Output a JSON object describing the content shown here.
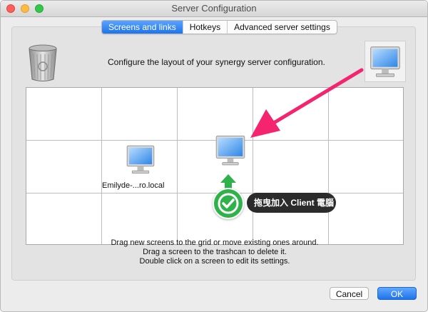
{
  "window": {
    "title": "Server Configuration"
  },
  "tabs": [
    {
      "label": "Screens and links",
      "active": true
    },
    {
      "label": "Hotkeys",
      "active": false
    },
    {
      "label": "Advanced server settings",
      "active": false
    }
  ],
  "instruction": "Configure the layout of your synergy server configuration.",
  "screens": [
    {
      "label": "Emilyde-...ro.local"
    },
    {
      "label": ""
    }
  ],
  "callout": {
    "text": "拖曳加入 Client 電腦"
  },
  "help_lines": [
    "Drag new screens to the grid or move existing ones around.",
    "Drag a screen to the trashcan to delete it.",
    "Double click on a screen to edit its settings."
  ],
  "buttons": {
    "cancel": "Cancel",
    "ok": "OK"
  },
  "colors": {
    "accent": "#1e73e8",
    "annotation_arrow": "#f4256e",
    "callout_check": "#2fb24a"
  },
  "icons": [
    "trash-icon",
    "monitor-icon",
    "check-icon",
    "arrow-up-icon",
    "pointer-arrow-icon"
  ]
}
